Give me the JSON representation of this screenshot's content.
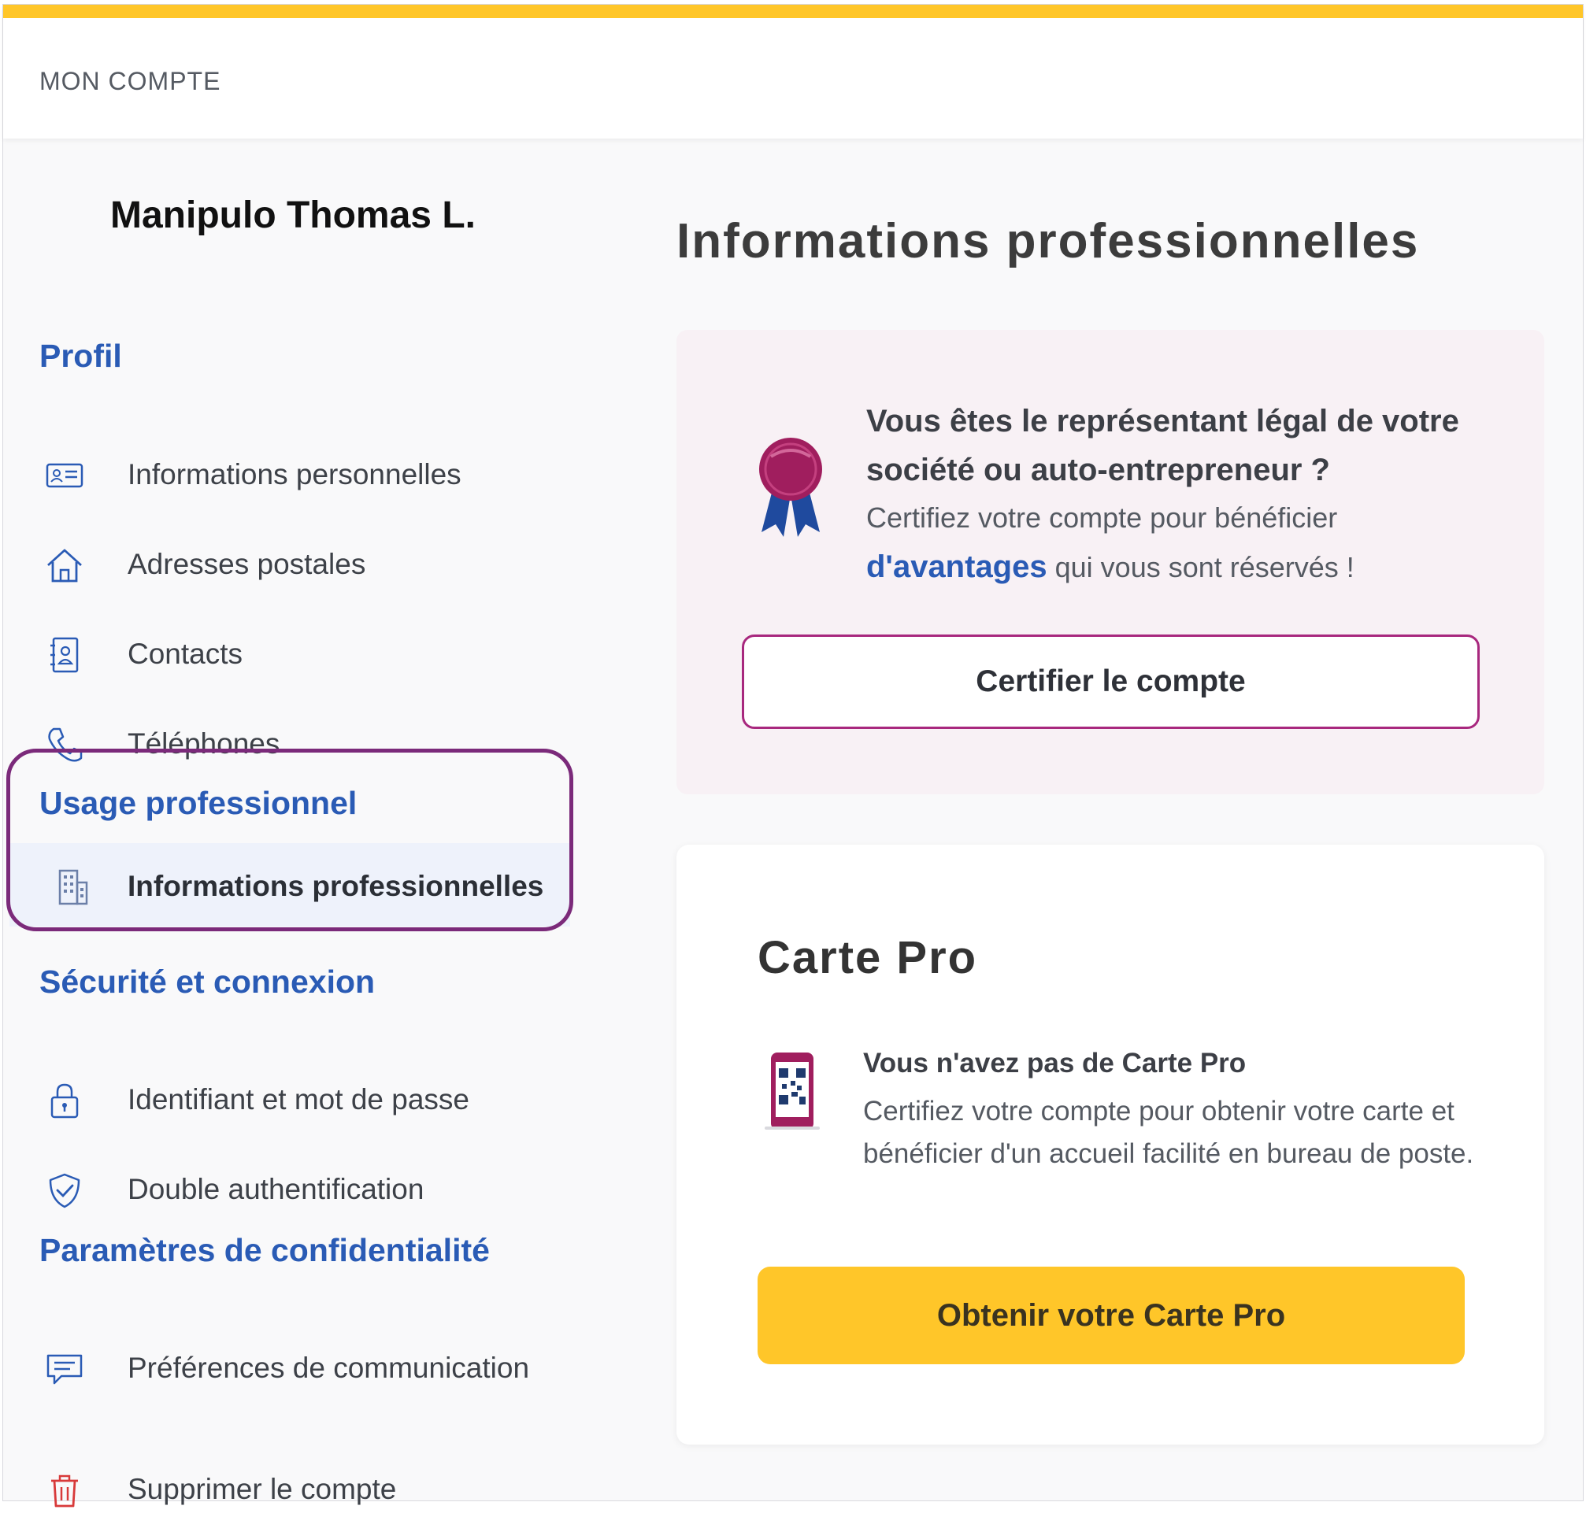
{
  "header": {
    "title": "MON COMPTE"
  },
  "user": {
    "name": "Manipulo Thomas L."
  },
  "sidebar": {
    "profil": {
      "title": "Profil",
      "items": [
        {
          "label": "Informations personnelles",
          "icon": "id-card-icon"
        },
        {
          "label": "Adresses postales",
          "icon": "house-icon"
        },
        {
          "label": "Contacts",
          "icon": "contact-book-icon"
        },
        {
          "label": "Téléphones",
          "icon": "phone-icon"
        }
      ]
    },
    "pro": {
      "title": "Usage professionnel",
      "items": [
        {
          "label": "Informations professionnelles",
          "icon": "building-icon",
          "active": true
        }
      ]
    },
    "securite": {
      "title": "Sécurité et connexion",
      "items": [
        {
          "label": "Identifiant et mot de passe",
          "icon": "lock-icon"
        },
        {
          "label": "Double authentification",
          "icon": "shield-check-icon"
        }
      ]
    },
    "confidentialite": {
      "title": "Paramètres de confidentialité",
      "items": [
        {
          "label": "Préférences de communication",
          "icon": "message-icon"
        }
      ]
    },
    "delete": {
      "label": "Supprimer le compte",
      "icon": "trash-icon"
    }
  },
  "main": {
    "title": "Informations professionnelles",
    "certify": {
      "heading": "Vous êtes le représentant légal de votre société ou auto-entrepreneur ?",
      "desc_before": "Certifiez votre compte pour bénéficier",
      "link": "d'avantages",
      "desc_after": "qui vous sont réservés !",
      "button": "Certifier le compte",
      "icon": "award-ribbon-icon"
    },
    "carte": {
      "title": "Carte Pro",
      "subtitle": "Vous n'avez pas de Carte Pro",
      "desc": "Certifiez votre compte pour obtenir votre carte et bénéficier d'un accueil facilité en bureau de poste.",
      "button": "Obtenir votre Carte Pro",
      "icon": "phone-qr-icon"
    }
  },
  "colors": {
    "accent_yellow": "#ffc629",
    "nav_blue": "#2a5bb5",
    "highlight_purple": "#7b2a7a",
    "button_border": "#a8287e",
    "card_pink": "#f8f1f5",
    "ribbon": "#a01e5e"
  }
}
